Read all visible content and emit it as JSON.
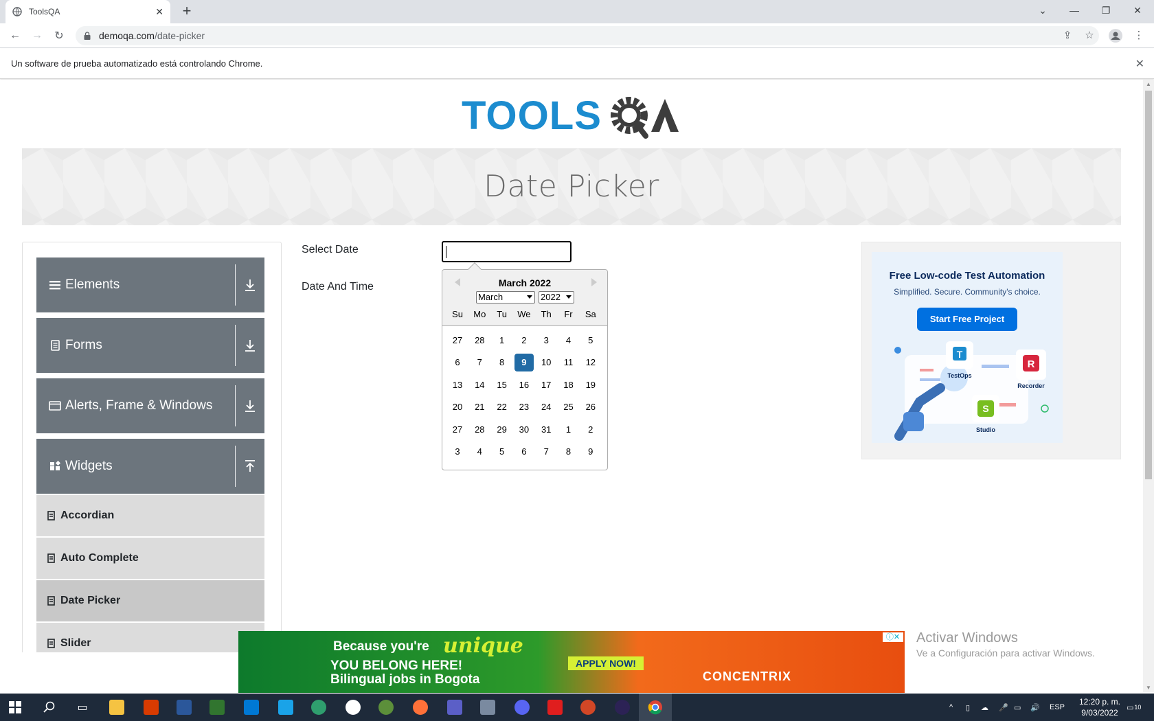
{
  "browser": {
    "tab_title": "ToolsQA",
    "url_host": "demoqa.com",
    "url_path": "/date-picker",
    "infobar_text": "Un software de prueba automatizado está controlando Chrome."
  },
  "page": {
    "title": "Date Picker",
    "logo_text": "TOOLSQA"
  },
  "sidebar": {
    "groups": [
      {
        "label": "Elements",
        "icon": "hamburger-icon",
        "expanded": false
      },
      {
        "label": "Forms",
        "icon": "document-icon",
        "expanded": false
      },
      {
        "label": "Alerts, Frame & Windows",
        "icon": "window-icon",
        "expanded": false
      },
      {
        "label": "Widgets",
        "icon": "widgets-icon",
        "expanded": true
      }
    ],
    "items": [
      {
        "label": "Accordian",
        "active": false
      },
      {
        "label": "Auto Complete",
        "active": false
      },
      {
        "label": "Date Picker",
        "active": true
      },
      {
        "label": "Slider",
        "active": false
      }
    ]
  },
  "form": {
    "select_date_label": "Select Date",
    "date_time_label": "Date And Time",
    "select_date_value": ""
  },
  "calendar": {
    "header": "March 2022",
    "month_select": "March",
    "year_select": "2022",
    "weekdays": [
      "Su",
      "Mo",
      "Tu",
      "We",
      "Th",
      "Fr",
      "Sa"
    ],
    "weeks": [
      [
        "27",
        "28",
        "1",
        "2",
        "3",
        "4",
        "5"
      ],
      [
        "6",
        "7",
        "8",
        "9",
        "10",
        "11",
        "12"
      ],
      [
        "13",
        "14",
        "15",
        "16",
        "17",
        "18",
        "19"
      ],
      [
        "20",
        "21",
        "22",
        "23",
        "24",
        "25",
        "26"
      ],
      [
        "27",
        "28",
        "29",
        "30",
        "31",
        "1",
        "2"
      ],
      [
        "3",
        "4",
        "5",
        "6",
        "7",
        "8",
        "9"
      ]
    ],
    "selected_day": "9",
    "accent_color": "#216ba5"
  },
  "ad_side": {
    "title": "Free Low-code Test Automation",
    "subtitle": "Simplified. Secure. Community's choice.",
    "button": "Start Free Project",
    "label_testops": "TestOps",
    "label_recorder": "Recorder",
    "label_studio": "Studio"
  },
  "ad_bottom": {
    "line1": "Because you're",
    "unique": "unique",
    "line2": "YOU BELONG HERE!",
    "line3": "Bilingual jobs in Bogota",
    "apply": "APPLY NOW!",
    "brand": "CONCENTRIX"
  },
  "windows": {
    "activate_title": "Activar Windows",
    "activate_sub": "Ve a Configuración para activar Windows.",
    "language": "ESP",
    "time": "12:20 p. m.",
    "date": "9/03/2022",
    "notifications": "10"
  }
}
